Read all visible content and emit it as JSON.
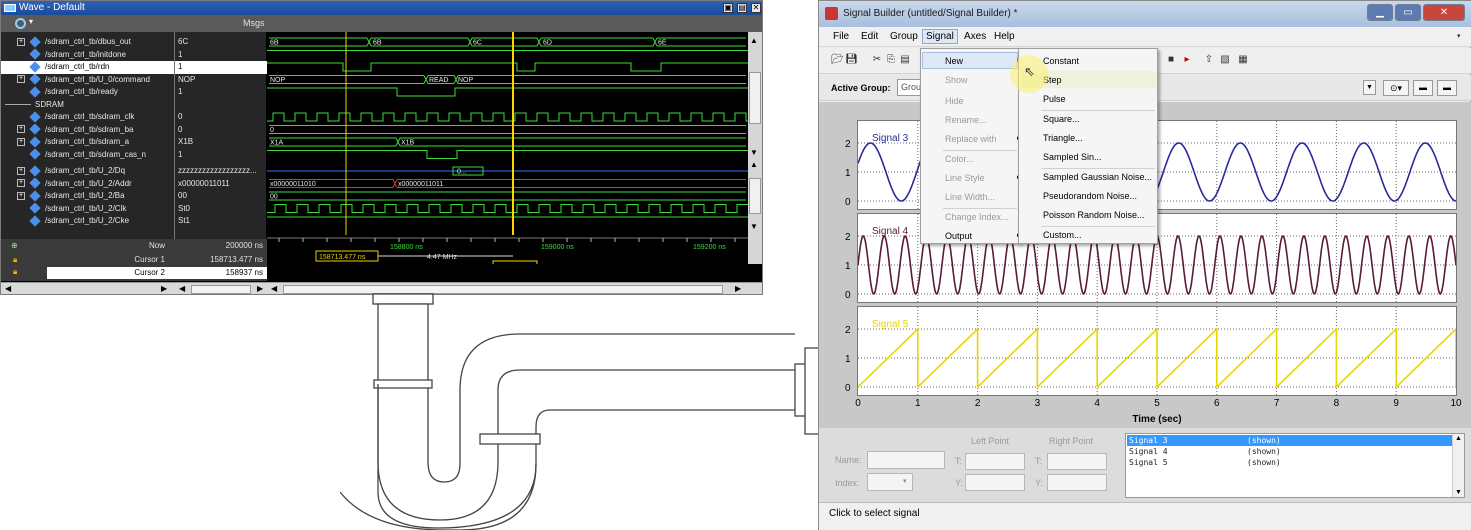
{
  "wave": {
    "title": "Wave - Default",
    "msgs_header": "Msgs",
    "signals": [
      {
        "name": "/sdram_ctrl_tb/dbus_out",
        "value": "6C",
        "expandable": true
      },
      {
        "name": "/sdram_ctrl_tb/initdone",
        "value": "1",
        "expandable": false
      },
      {
        "name": "/sdram_ctrl_tb/rdn",
        "value": "1",
        "expandable": false,
        "selected": true
      },
      {
        "name": "/sdram_ctrl_tb/U_0/command",
        "value": "NOP",
        "expandable": true
      },
      {
        "name": "/sdram_ctrl_tb/ready",
        "value": "1",
        "expandable": false
      },
      {
        "name": "SDRAM",
        "value": "",
        "group": true
      },
      {
        "name": "/sdram_ctrl_tb/sdram_clk",
        "value": "0",
        "expandable": false
      },
      {
        "name": "/sdram_ctrl_tb/sdram_ba",
        "value": "0",
        "expandable": true
      },
      {
        "name": "/sdram_ctrl_tb/sdram_a",
        "value": "X1B",
        "expandable": true
      },
      {
        "name": "/sdram_ctrl_tb/sdram_cas_n",
        "value": "1",
        "expandable": false
      },
      {
        "name": "/sdram_ctrl_tb/U_2/Dq",
        "value": "zzzzzzzzzzzzzzzzzz...",
        "expandable": true
      },
      {
        "name": "/sdram_ctrl_tb/U_2/Addr",
        "value": "x00000011011",
        "expandable": true
      },
      {
        "name": "/sdram_ctrl_tb/U_2/Ba",
        "value": "00",
        "expandable": true
      },
      {
        "name": "/sdram_ctrl_tb/U_2/Clk",
        "value": "St0",
        "expandable": false
      },
      {
        "name": "/sdram_ctrl_tb/U_2/Cke",
        "value": "St1",
        "expandable": false
      }
    ],
    "bus_labels": {
      "dbus_out": [
        "6B",
        "6B",
        "6C",
        "6D",
        "6E"
      ],
      "command": [
        "NOP",
        "READ",
        "NOP"
      ],
      "sdram_ba": "0",
      "sdram_a": [
        "X1A",
        "X1B"
      ],
      "dq": "0...",
      "addr": [
        "x00000011010",
        "x00000011011"
      ],
      "ba": "00"
    },
    "cursors": [
      {
        "label": "Now",
        "value": "200000 ns"
      },
      {
        "label": "Cursor 1",
        "value": "158713.477 ns"
      },
      {
        "label": "Cursor 2",
        "value": "158937 ns"
      }
    ],
    "timeline": [
      "158800 ns",
      "159000 ns",
      "159200 ns"
    ],
    "cursor1_tag": "158713.477 ns",
    "cursor2_tag": "158937 ns",
    "freq_tag": "4.47 MHz"
  },
  "sb": {
    "title": "Signal Builder (untitled/Signal Builder) *",
    "menu": [
      "File",
      "Edit",
      "Group",
      "Signal",
      "Axes",
      "Help"
    ],
    "active_group_label": "Active Group:",
    "active_group_value": "Grou",
    "signal_menu": [
      {
        "label": "New",
        "enabled": true,
        "submenu": true
      },
      {
        "label": "Show",
        "enabled": false
      },
      {
        "label": "Hide",
        "enabled": false
      },
      {
        "label": "Rename...",
        "enabled": false
      },
      {
        "label": "Replace with",
        "enabled": false,
        "submenu": true
      },
      {
        "label": "Color...",
        "enabled": false
      },
      {
        "label": "Line Style",
        "enabled": false,
        "submenu": true
      },
      {
        "label": "Line Width...",
        "enabled": false
      },
      {
        "label": "Change Index...",
        "enabled": false
      },
      {
        "label": "Output",
        "enabled": true,
        "submenu": true
      }
    ],
    "new_submenu": [
      "Constant",
      "Step",
      "Pulse",
      "Square...",
      "Triangle...",
      "Sampled Sin...",
      "Sampled Gaussian Noise...",
      "Pseudorandom Noise...",
      "Poisson Random Noise...",
      "Custom..."
    ],
    "plots": [
      {
        "signal": "Signal 3",
        "color": "#2a2a9a",
        "yticks": [
          "2",
          "1",
          "0"
        ]
      },
      {
        "signal": "Signal 4",
        "color": "#5a1a3a",
        "yticks": [
          "2",
          "1",
          "0"
        ]
      },
      {
        "signal": "Signal 5",
        "color": "#e6d800",
        "yticks": [
          "2",
          "1",
          "0"
        ]
      }
    ],
    "xticks": [
      "0",
      "1",
      "2",
      "3",
      "4",
      "5",
      "6",
      "7",
      "8",
      "9",
      "10"
    ],
    "xlabel": "Time (sec)",
    "left_point": "Left Point",
    "right_point": "Right Point",
    "name_label": "Name:",
    "index_label": "Index:",
    "t_label": "T:",
    "y_label": "Y:",
    "signal_list": [
      {
        "name": "Signal 3",
        "status": "(shown)",
        "selected": true
      },
      {
        "name": "Signal 4",
        "status": "(shown)",
        "selected": false
      },
      {
        "name": "Signal 5",
        "status": "(shown)",
        "selected": false
      }
    ],
    "status": "Click to select signal"
  }
}
